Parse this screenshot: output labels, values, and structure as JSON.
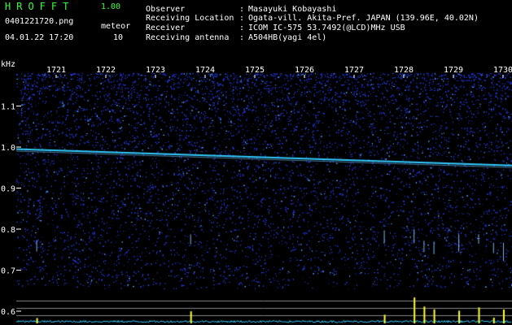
{
  "header": {
    "app_title": "HROFFT",
    "version": "1.00",
    "file_name": "0401221720.png",
    "detection_type": "meteor",
    "date_time": "04.01.22 17:20",
    "detection_count": "10"
  },
  "station_info": [
    {
      "key": "Observer",
      "value": "Masayuki Kobayashi"
    },
    {
      "key": "Receiving Location",
      "value": "Ogata-vill. Akita-Pref. JAPAN (139.96E, 40.02N)"
    },
    {
      "key": "Receiver",
      "value": "ICOM IC-575 53.7492(@LCD)MHz USB"
    },
    {
      "key": "Receiving antenna",
      "value": "A504HB(yagi 4el)"
    }
  ],
  "info_separator": ":",
  "spectrogram": {
    "y_unit": "kHz",
    "y_ticks": [
      "1.1",
      "1.0",
      "0.9",
      "0.8",
      "0.7",
      "0.6"
    ],
    "time_ticks": [
      "1721",
      "1722",
      "1723",
      "1724",
      "1725",
      "1726",
      "1727",
      "1728",
      "1729",
      "1730"
    ],
    "colors": {
      "background": "#000000",
      "noise": "#2233cc",
      "carrier": "#33ccff",
      "meteor_echo": "#ffff33",
      "level_line": "#33ccff",
      "guide_line": "#888888"
    },
    "carrier_trace_khz": {
      "start": 0.995,
      "end": 0.955
    },
    "meteor_echo_minutes": [
      1720.6,
      1723.7,
      1727.6,
      1728.2,
      1728.4,
      1728.6,
      1729.1,
      1729.5,
      1730.0,
      1729.8
    ]
  }
}
